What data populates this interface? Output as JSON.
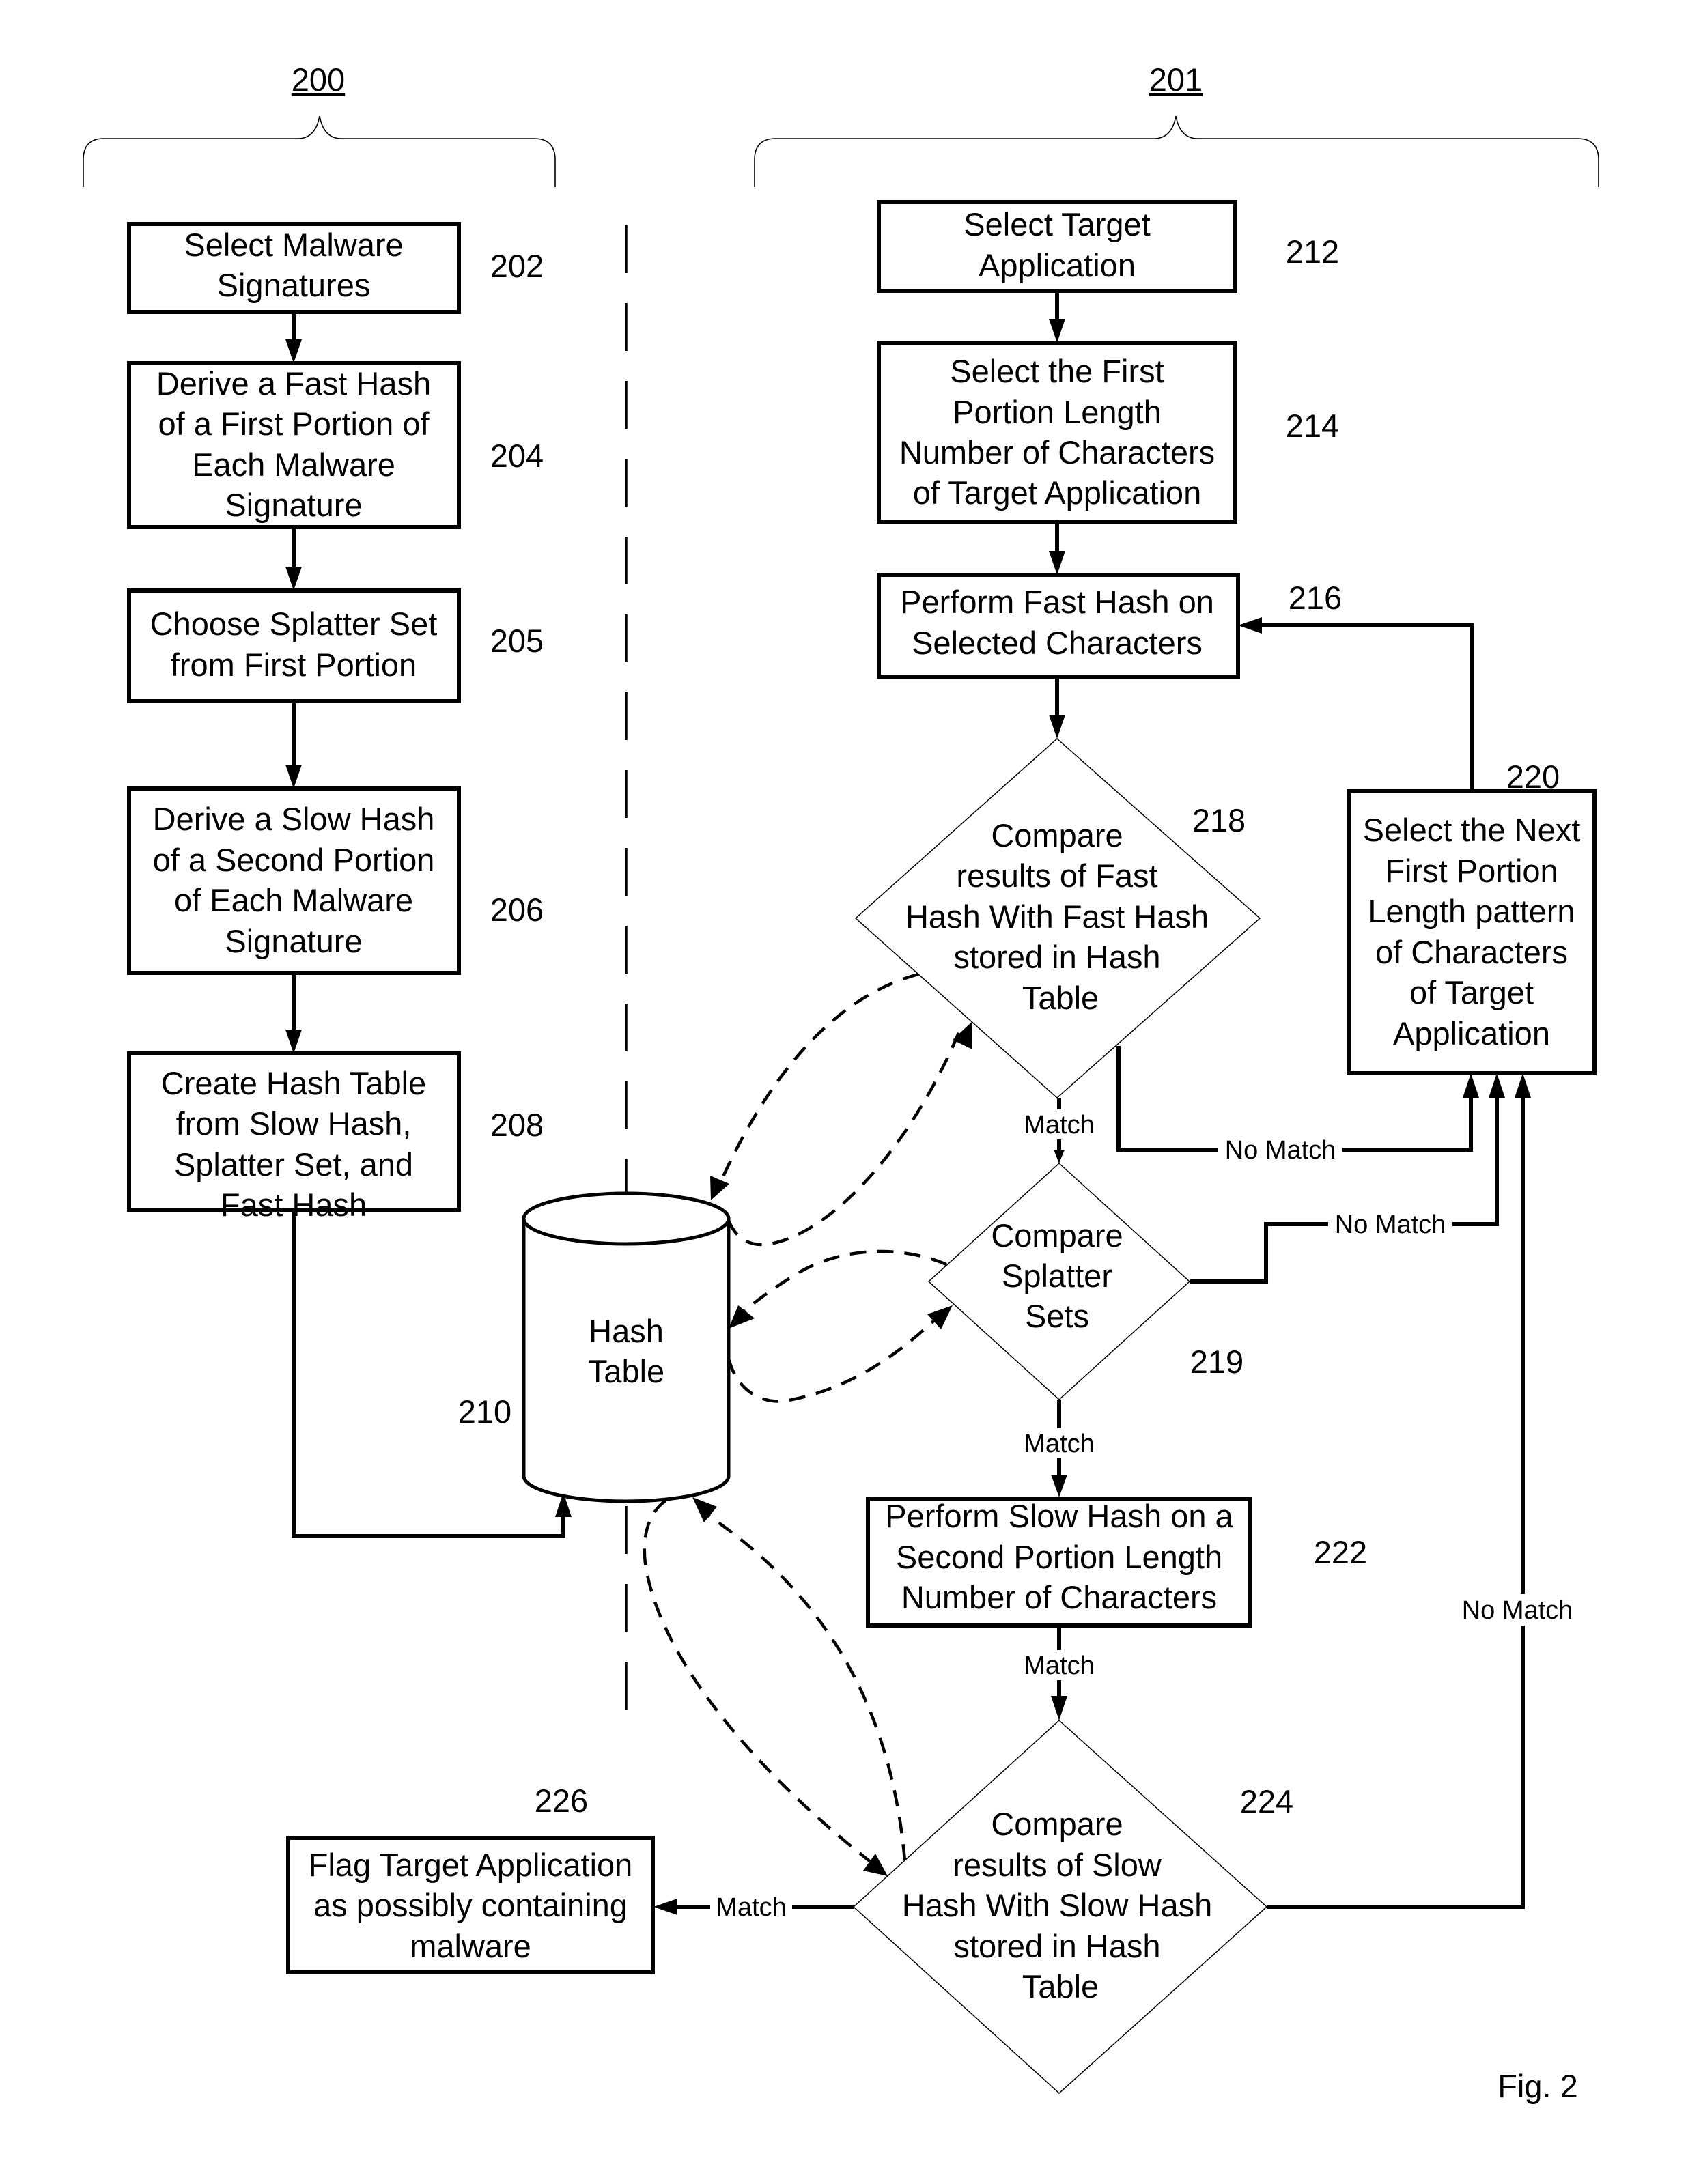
{
  "figure": {
    "caption": "Fig. 2",
    "groups": [
      {
        "id": "200",
        "label": "200"
      },
      {
        "id": "201",
        "label": "201"
      }
    ],
    "nodes": {
      "n202": {
        "ref": "202",
        "shape": "rectangle",
        "lines": [
          "Select Malware",
          "Signatures"
        ]
      },
      "n204": {
        "ref": "204",
        "shape": "rectangle",
        "lines": [
          "Derive a Fast Hash",
          "of a First Portion of",
          "Each Malware",
          "Signature"
        ]
      },
      "n205": {
        "ref": "205",
        "shape": "rectangle",
        "lines": [
          "Choose Splatter Set",
          "from First Portion"
        ]
      },
      "n206": {
        "ref": "206",
        "shape": "rectangle",
        "lines": [
          "Derive a Slow Hash",
          "of a Second Portion",
          "of Each Malware",
          "Signature"
        ]
      },
      "n208": {
        "ref": "208",
        "shape": "rectangle",
        "lines": [
          "Create Hash Table",
          "from Slow Hash,",
          "Splatter Set, and",
          "Fast Hash"
        ]
      },
      "n210": {
        "ref": "210",
        "shape": "cylinder",
        "lines": [
          "Hash",
          "Table"
        ]
      },
      "n212": {
        "ref": "212",
        "shape": "rectangle",
        "lines": [
          "Select Target",
          "Application"
        ]
      },
      "n214": {
        "ref": "214",
        "shape": "rectangle",
        "lines": [
          "Select the First",
          "Portion Length",
          "Number of Characters",
          "of Target Application"
        ]
      },
      "n216": {
        "ref": "216",
        "shape": "rectangle",
        "lines": [
          "Perform Fast Hash on",
          "Selected Characters"
        ]
      },
      "n218": {
        "ref": "218",
        "shape": "diamond",
        "lines": [
          "Compare",
          "results of Fast",
          "Hash With Fast Hash",
          "stored in Hash",
          "Table"
        ]
      },
      "n219": {
        "ref": "219",
        "shape": "diamond",
        "lines": [
          "Compare",
          "Splatter",
          "Sets"
        ]
      },
      "n220": {
        "ref": "220",
        "shape": "rectangle",
        "lines": [
          "Select the Next",
          "First Portion",
          "Length pattern",
          "of Characters",
          "of Target",
          "Application"
        ]
      },
      "n222": {
        "ref": "222",
        "shape": "rectangle",
        "lines": [
          "Perform Slow Hash on a",
          "Second Portion Length",
          "Number of Characters"
        ]
      },
      "n224": {
        "ref": "224",
        "shape": "diamond",
        "lines": [
          "Compare",
          "results of Slow",
          "Hash With Slow Hash",
          "stored in Hash",
          "Table"
        ]
      },
      "n226": {
        "ref": "226",
        "shape": "rectangle",
        "lines": [
          "Flag Target Application",
          "as possibly containing",
          "malware"
        ]
      }
    },
    "edge_labels": {
      "match_218_219": "Match",
      "nomatch_218_220": "No Match",
      "nomatch_219_220": "No Match",
      "match_219_222": "Match",
      "match_222_224": "Match",
      "nomatch_224_220": "No Match",
      "match_224_226": "Match"
    },
    "edges": [
      {
        "from": "202",
        "to": "204",
        "style": "solid"
      },
      {
        "from": "204",
        "to": "205",
        "style": "solid"
      },
      {
        "from": "205",
        "to": "206",
        "style": "solid"
      },
      {
        "from": "206",
        "to": "208",
        "style": "solid"
      },
      {
        "from": "208",
        "to": "210",
        "style": "solid"
      },
      {
        "from": "212",
        "to": "214",
        "style": "solid"
      },
      {
        "from": "214",
        "to": "216",
        "style": "solid"
      },
      {
        "from": "216",
        "to": "218",
        "style": "solid"
      },
      {
        "from": "218",
        "to": "219",
        "style": "solid",
        "label": "Match"
      },
      {
        "from": "218",
        "to": "220",
        "style": "solid",
        "label": "No Match"
      },
      {
        "from": "219",
        "to": "220",
        "style": "solid",
        "label": "No Match"
      },
      {
        "from": "219",
        "to": "222",
        "style": "solid",
        "label": "Match"
      },
      {
        "from": "222",
        "to": "224",
        "style": "solid",
        "label": "Match"
      },
      {
        "from": "224",
        "to": "220",
        "style": "solid",
        "label": "No Match"
      },
      {
        "from": "224",
        "to": "226",
        "style": "solid",
        "label": "Match"
      },
      {
        "from": "220",
        "to": "216",
        "style": "solid"
      },
      {
        "from": "218",
        "to": "210",
        "style": "dashed"
      },
      {
        "from": "210",
        "to": "218",
        "style": "dashed"
      },
      {
        "from": "219",
        "to": "210",
        "style": "dashed"
      },
      {
        "from": "210",
        "to": "219",
        "style": "dashed"
      },
      {
        "from": "210",
        "to": "224",
        "style": "dashed"
      },
      {
        "from": "224",
        "to": "210",
        "style": "dashed"
      }
    ]
  }
}
